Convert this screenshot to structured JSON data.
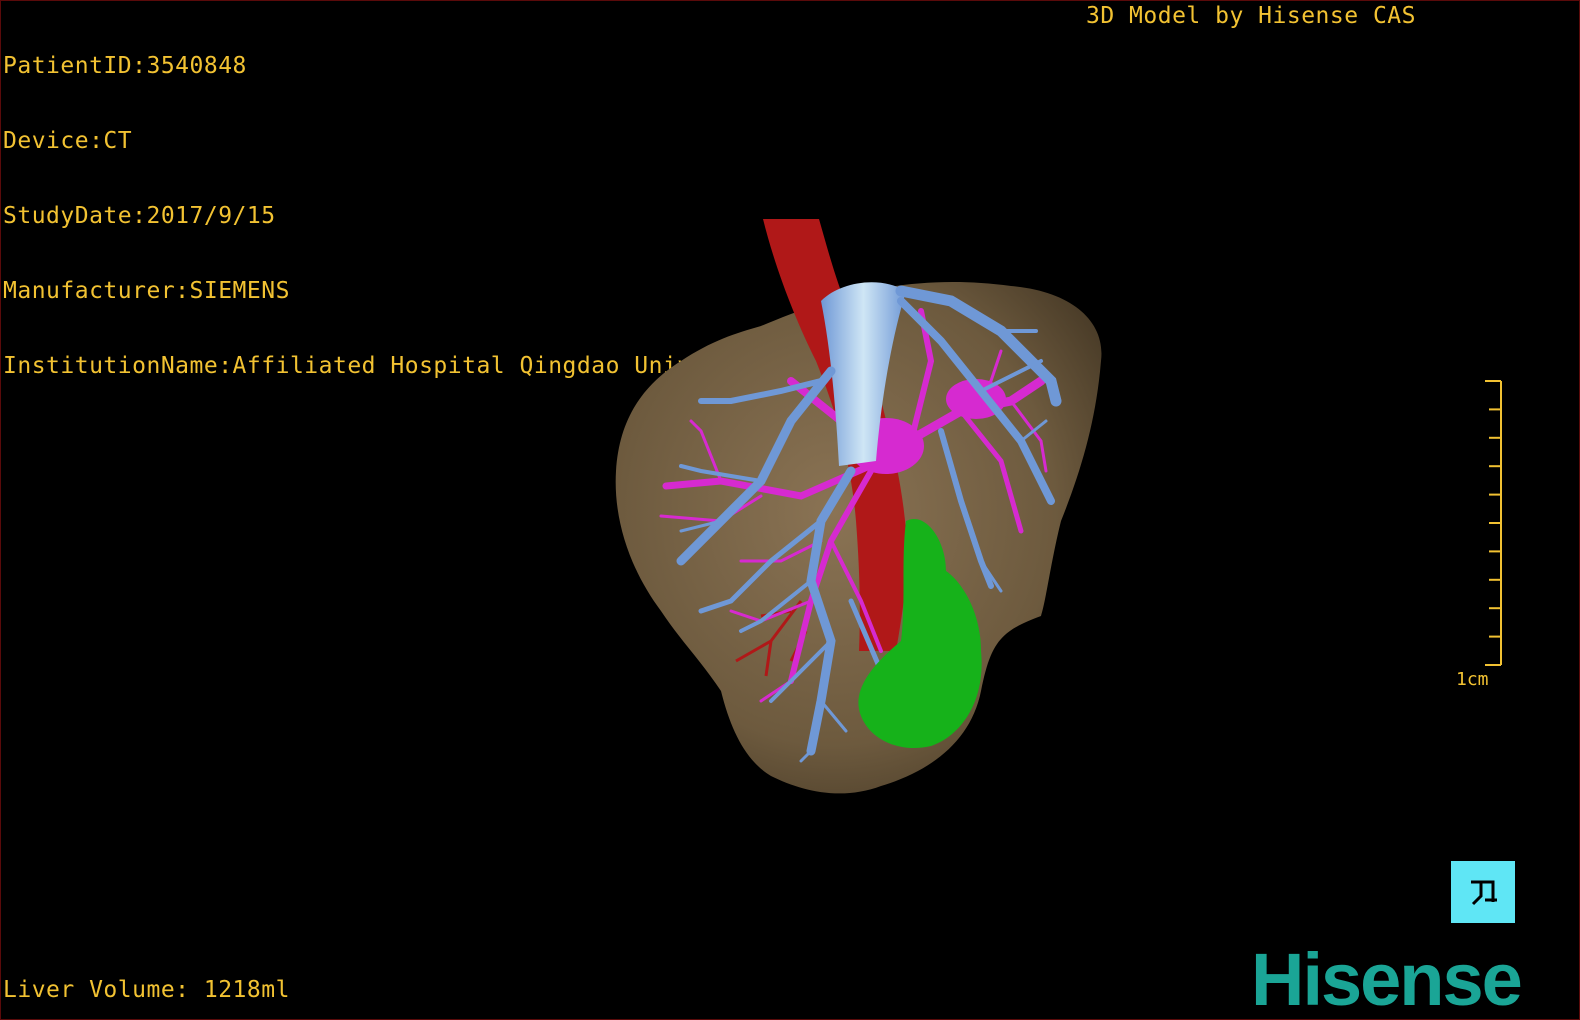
{
  "patient": {
    "id_line": "PatientID:3540848",
    "device_line": "Device:CT",
    "study_date_line": "StudyDate:2017/9/15",
    "manufacturer_line": "Manufacturer:SIEMENS",
    "institution_line": "InstitutionName:Affiliated Hospital Qingdao University-C"
  },
  "header": {
    "model_credit": "3D Model by Hisense CAS"
  },
  "footer": {
    "liver_volume": "Liver Volume: 1218ml"
  },
  "scale_bar": {
    "label": "1cm",
    "ticks": 10
  },
  "brand": {
    "logo_text": "Hisense"
  },
  "colors": {
    "text": "#f2c232",
    "liver": "#7a6446",
    "artery": "#b01818",
    "portal_vein": "#6f98d6",
    "hepatic_vein": "#d62ad0",
    "gallbladder": "#16b21a",
    "brand": "#1aa596",
    "orient_button": "#5fe6f5"
  },
  "icons": {
    "orientation": "orientation-reset-icon"
  }
}
